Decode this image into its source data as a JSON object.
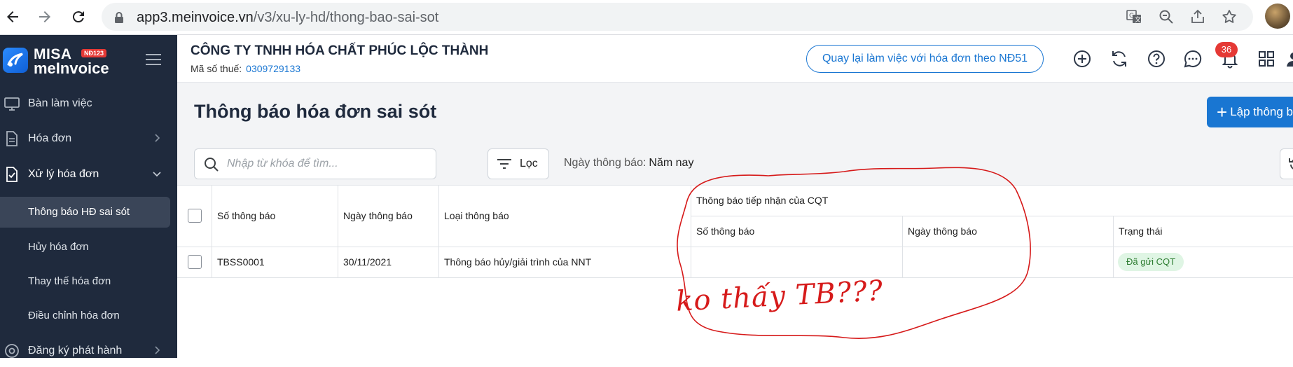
{
  "browser": {
    "url_host": "app3.meinvoice.vn",
    "url_path": "/v3/xu-ly-hd/thong-bao-sai-sot",
    "icons": [
      "back-icon",
      "forward-icon",
      "reload-icon",
      "lock-icon",
      "translate-icon",
      "zoom-out-icon",
      "share-icon",
      "bookmark-star-icon"
    ]
  },
  "brand": {
    "line1": "MISA",
    "line2": "meInvoice",
    "badge": "NĐ123",
    "accent": "#1976d2"
  },
  "sidebar": {
    "items": [
      {
        "label": "Bàn làm việc",
        "icon": "monitor-icon"
      },
      {
        "label": "Hóa đơn",
        "icon": "document-icon"
      },
      {
        "label": "Xử lý hóa đơn",
        "icon": "document-check-icon"
      },
      {
        "label": "Đăng ký phát hành",
        "icon": "location-icon"
      }
    ],
    "subitems": [
      {
        "label": "Thông báo HĐ sai sót",
        "active": true
      },
      {
        "label": "Hủy hóa đơn"
      },
      {
        "label": "Thay thế hóa đơn"
      },
      {
        "label": "Điều chỉnh hóa đơn"
      }
    ]
  },
  "header": {
    "company": "CÔNG TY TNHH HÓA CHẤT PHÚC LỘC THÀNH",
    "tax_label": "Mã số thuế:",
    "tax_value": "0309729133",
    "nd51_button": "Quay lại làm việc với hóa đơn theo NĐ51",
    "notification_count": "36",
    "icons": [
      "add-circle-icon",
      "sync-icon",
      "help-icon",
      "chat-icon",
      "bell-icon",
      "apps-grid-icon",
      "user-icon"
    ]
  },
  "page": {
    "title": "Thông báo hóa đơn sai sót",
    "create_button": "Lập thông b",
    "search_placeholder": "Nhập từ khóa để tìm...",
    "filter_label": "Lọc",
    "date_filter_label": "Ngày thông báo:",
    "date_filter_value": "Năm nay"
  },
  "table": {
    "headers": {
      "so_thong_bao": "Số thông báo",
      "ngay_thong_bao": "Ngày thông báo",
      "loai_thong_bao": "Loại thông báo",
      "cqt_group": "Thông báo tiếp nhận của CQT",
      "cqt_so": "Số thông báo",
      "cqt_ngay": "Ngày thông báo",
      "trang_thai": "Trạng thái"
    },
    "rows": [
      {
        "so_thong_bao": "TBSS0001",
        "ngay_thong_bao": "30/11/2021",
        "loai_thong_bao": "Thông báo hủy/giải trình của NNT",
        "cqt_so": "",
        "cqt_ngay": "",
        "trang_thai": "Đã gửi CQT"
      }
    ]
  },
  "annotation": {
    "text": "ko thấy TB???",
    "color": "#d61a1a"
  }
}
